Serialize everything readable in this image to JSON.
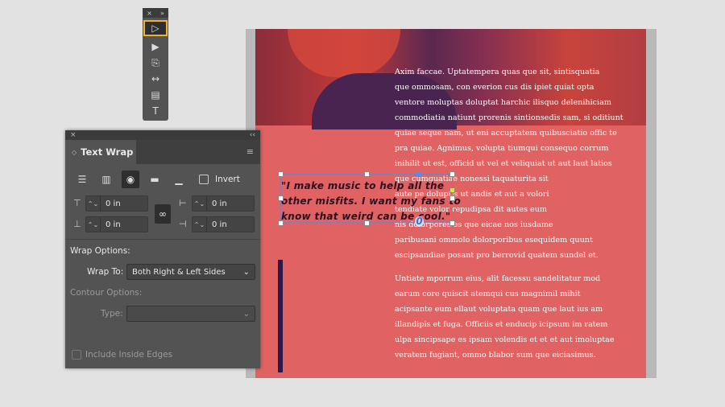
{
  "toolbar": {
    "close": "×",
    "collapse": "»",
    "tools": [
      {
        "name": "selection-tool",
        "glyph": "▷"
      },
      {
        "name": "direct-selection-tool",
        "glyph": "▶"
      },
      {
        "name": "page-tool",
        "glyph": "⎘"
      },
      {
        "name": "gap-tool",
        "glyph": "↔"
      },
      {
        "name": "content-collector-tool",
        "glyph": "▤"
      },
      {
        "name": "type-tool",
        "glyph": "T"
      }
    ]
  },
  "panel": {
    "close": "×",
    "collapse": "‹‹",
    "title": "Text Wrap",
    "menu": "≡",
    "invert_label": "Invert",
    "offsets": {
      "top": "0 in",
      "bottom": "0 in",
      "left": "0 in",
      "right": "0 in"
    },
    "wrap_options_label": "Wrap Options:",
    "wrap_to_label": "Wrap To:",
    "wrap_to_value": "Both Right & Left Sides",
    "contour_options_label": "Contour Options:",
    "type_label": "Type:",
    "type_value": "",
    "include_inside_edges": "Include Inside Edges"
  },
  "document": {
    "quote_lines": [
      "\"I make music to help all the",
      "other misfits. I want my fans to",
      "know that weird can be cool.\""
    ],
    "para1": [
      "Axim faccae. Uptatempera quas que sit, sintisquatia",
      "que ommosam, con everion cus dis ipiet quiat opta",
      "ventore moluptas doluptat harchic ilisquo delenihiciam",
      "commodiatia natiunt prorenis sintionsedis sam, si odit­iunt",
      "quiae seque nam, ut eni accuptatem quibusciatio offic te",
      "pra quiae. Agnimus, volupta tiumqui consequo corrum",
      "inihilit ut est, officid ut vel et veliquiat ut aut laut latios",
      "que cumquatiae nonessi taquaturita sit",
      "aute pe doluptis ut andis et aut a volori",
      "tendiate volor repudipsa dit autes eum",
      "nis dolorpores es que eicae nos iusdame",
      "paribusani ommolo dolorporibus esequidem quunt",
      "escipsandiae posant pro berrovid quatem sundel et."
    ],
    "para2": [
      "Untiate mporrum eius, alit facessu sandelitatur mod",
      "earum core quiscit atemqui cus magnimil mihit",
      "acipsante eum ellaut voluptata quam que laut ius am",
      "illandipis et fuga. Officiis et enducip icipsum im ratem",
      "ulpa sincipsape es ipsam volendis et et et aut imoluptae",
      "veratem fugiant, ommo blabor sum que eiciasimus."
    ]
  }
}
